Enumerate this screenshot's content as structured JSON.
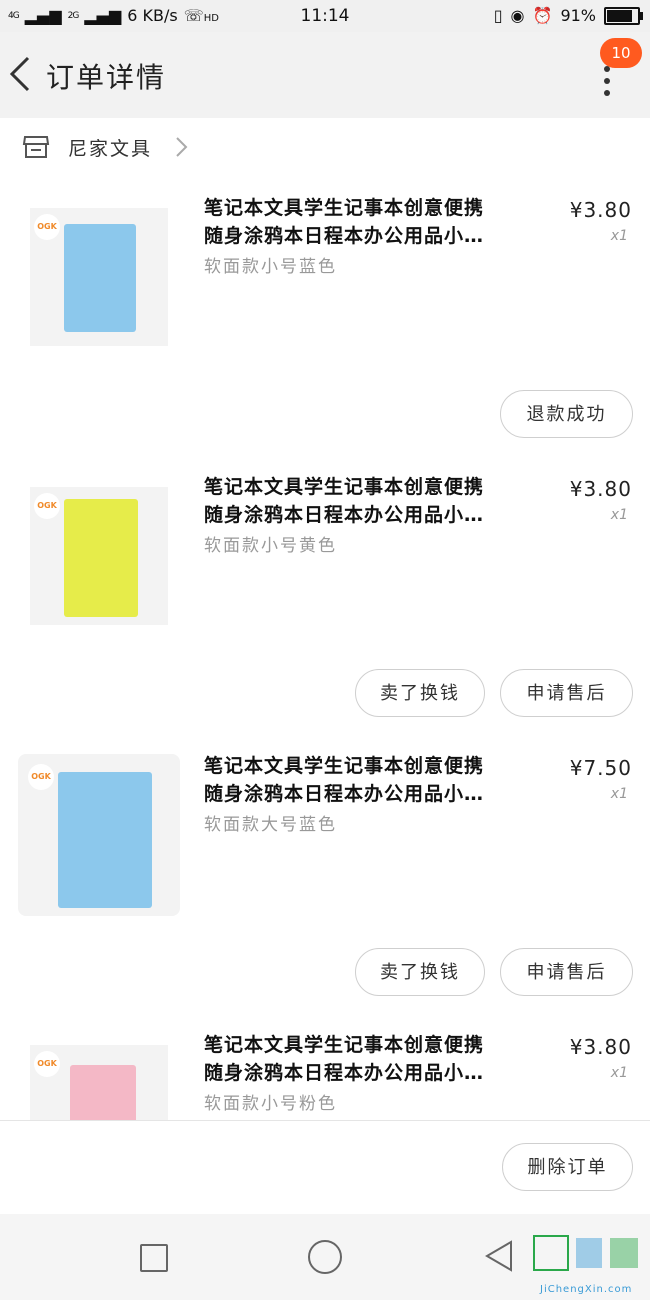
{
  "status_bar": {
    "network_left": "4G",
    "network_right": "2G",
    "speed": "6 KB/s",
    "hd": "HD",
    "time": "11:14",
    "battery": "91%",
    "battery_level": 0.91
  },
  "header": {
    "title": "订单详情",
    "badge": "10"
  },
  "shop": {
    "name": "尼家文具"
  },
  "items": [
    {
      "title_line1": "笔记本文具学生记事本创意便携",
      "title_line2": "随身涂鸦本日程本办公用品小…",
      "spec": "软面款小号蓝色",
      "price": "¥3.80",
      "qty": "x1",
      "book_color": "#8cc8ec",
      "buttons": [
        "退款成功"
      ]
    },
    {
      "title_line1": "笔记本文具学生记事本创意便携",
      "title_line2": "随身涂鸦本日程本办公用品小…",
      "spec": "软面款小号黄色",
      "price": "¥3.80",
      "qty": "x1",
      "book_color": "#e6ec4a",
      "buttons": [
        "卖了换钱",
        "申请售后"
      ]
    },
    {
      "title_line1": "笔记本文具学生记事本创意便携",
      "title_line2": "随身涂鸦本日程本办公用品小…",
      "spec": "软面款大号蓝色",
      "price": "¥7.50",
      "qty": "x1",
      "book_color": "#8cc8ec",
      "buttons": [
        "卖了换钱",
        "申请售后"
      ]
    },
    {
      "title_line1": "笔记本文具学生记事本创意便携",
      "title_line2": "随身涂鸦本日程本办公用品小…",
      "spec": "软面款小号粉色",
      "price": "¥3.80",
      "qty": "x1",
      "book_color": "#f4b8c6",
      "buttons": []
    }
  ],
  "footer": {
    "delete_label": "删除订单"
  },
  "watermark": {
    "text": "JiChengXin.com"
  },
  "colors": {
    "badge": "#ff5a1f",
    "nav_bg": "#f2f2f2"
  }
}
